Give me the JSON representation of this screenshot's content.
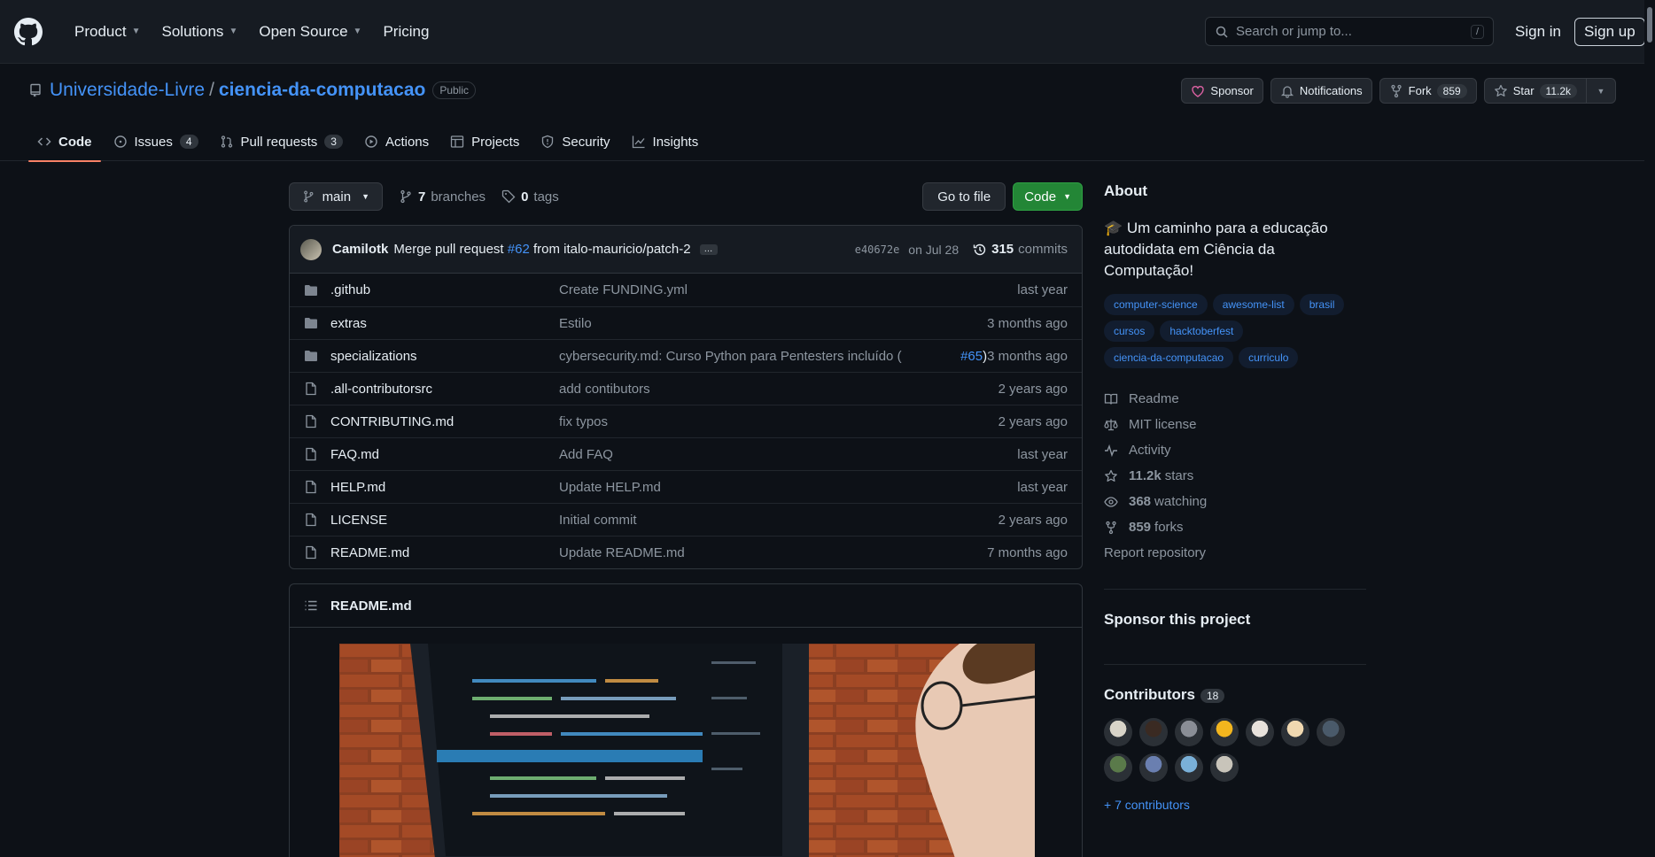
{
  "header": {
    "nav": [
      {
        "label": "Product",
        "has_menu": true
      },
      {
        "label": "Solutions",
        "has_menu": true
      },
      {
        "label": "Open Source",
        "has_menu": true
      },
      {
        "label": "Pricing",
        "has_menu": false
      }
    ],
    "search_placeholder": "Search or jump to...",
    "search_shortcut": "/",
    "signin": "Sign in",
    "signup": "Sign up"
  },
  "repo": {
    "owner": "Universidade-Livre",
    "separator": "/",
    "name": "ciencia-da-computacao",
    "visibility": "Public",
    "actions": {
      "sponsor": "Sponsor",
      "notifications": "Notifications",
      "fork": "Fork",
      "fork_count": "859",
      "star": "Star",
      "star_count": "11.2k"
    },
    "tabs": [
      {
        "label": "Code",
        "count": null,
        "icon": "code-icon"
      },
      {
        "label": "Issues",
        "count": "4",
        "icon": "issue-icon"
      },
      {
        "label": "Pull requests",
        "count": "3",
        "icon": "pull-request-icon"
      },
      {
        "label": "Actions",
        "count": null,
        "icon": "play-icon"
      },
      {
        "label": "Projects",
        "count": null,
        "icon": "table-icon"
      },
      {
        "label": "Security",
        "count": null,
        "icon": "shield-icon"
      },
      {
        "label": "Insights",
        "count": null,
        "icon": "graph-icon"
      }
    ]
  },
  "toolbar": {
    "branch": "main",
    "branches_count": "7",
    "branches_label": "branches",
    "tags_count": "0",
    "tags_label": "tags",
    "goto_file": "Go to file",
    "code": "Code"
  },
  "commit": {
    "author": "Camilotk",
    "message_prefix": "Merge pull request",
    "pr_link": "#62",
    "message_suffix": "from italo-mauricio/patch-2",
    "ellipsis": "…",
    "sha": "e40672e",
    "date": "on Jul 28",
    "commits_count": "315",
    "commits_label": "commits"
  },
  "files": [
    {
      "type": "dir",
      "name": ".github",
      "message": "Create FUNDING.yml",
      "link": null,
      "message_end": "",
      "date": "last year"
    },
    {
      "type": "dir",
      "name": "extras",
      "message": "Estilo",
      "link": null,
      "message_end": "",
      "date": "3 months ago"
    },
    {
      "type": "dir",
      "name": "specializations",
      "message": "cybersecurity.md: Curso Python para Pentesters incluído (",
      "link": "#65",
      "message_end": ")",
      "date": "3 months ago"
    },
    {
      "type": "file",
      "name": ".all-contributorsrc",
      "message": "add contibutors",
      "link": null,
      "message_end": "",
      "date": "2 years ago"
    },
    {
      "type": "file",
      "name": "CONTRIBUTING.md",
      "message": "fix typos",
      "link": null,
      "message_end": "",
      "date": "2 years ago"
    },
    {
      "type": "file",
      "name": "FAQ.md",
      "message": "Add FAQ",
      "link": null,
      "message_end": "",
      "date": "last year"
    },
    {
      "type": "file",
      "name": "HELP.md",
      "message": "Update HELP.md",
      "link": null,
      "message_end": "",
      "date": "last year"
    },
    {
      "type": "file",
      "name": "LICENSE",
      "message": "Initial commit",
      "link": null,
      "message_end": "",
      "date": "2 years ago"
    },
    {
      "type": "file",
      "name": "README.md",
      "message": "Update README.md",
      "link": null,
      "message_end": "",
      "date": "7 months ago"
    }
  ],
  "readme": {
    "title": "README.md"
  },
  "about": {
    "heading": "About",
    "description": "🎓 Um caminho para a educação autodidata em Ciência da Computação!",
    "topics": [
      "computer-science",
      "awesome-list",
      "brasil",
      "cursos",
      "hacktoberfest",
      "ciencia-da-computacao",
      "curriculo"
    ],
    "readme": "Readme",
    "license": "MIT license",
    "activity": "Activity",
    "stars_count": "11.2k",
    "stars_label": "stars",
    "watching_count": "368",
    "watching_label": "watching",
    "forks_count": "859",
    "forks_label": "forks",
    "report": "Report repository"
  },
  "sponsor": {
    "heading": "Sponsor this project"
  },
  "contributors": {
    "heading": "Contributors",
    "count": "18",
    "more": "+ 7 contributors",
    "avatar_colors": [
      "#d8d4c8",
      "#3a2a22",
      "#8a8e96",
      "#f2b51e",
      "#e8e2dc",
      "#f0d8b0",
      "#4a5a6a",
      "#5a7a4a",
      "#6a7fb0",
      "#7ab0d8",
      "#c8c4ba"
    ]
  },
  "colors": {
    "accent_blue": "#4493f8",
    "green_button": "#238636",
    "active_tab_underline": "#f78166",
    "background": "#0d1117"
  }
}
